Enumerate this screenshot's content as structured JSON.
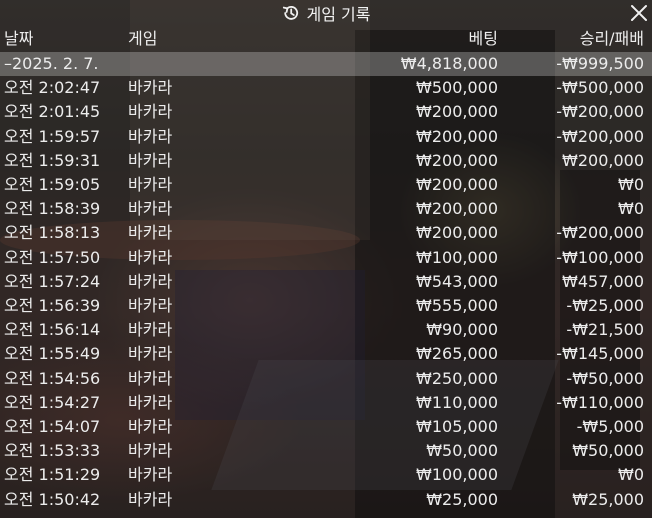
{
  "title": "게임 기록",
  "icons": {
    "title": "history-icon",
    "close": "close-icon"
  },
  "columns": {
    "date": "날짜",
    "game": "게임",
    "bet": "베팅",
    "result": "승리/패배"
  },
  "summary": {
    "date": "–2025. 2. 7.",
    "game": "",
    "bet": "₩4,818,000",
    "result": "-₩999,500"
  },
  "rows": [
    {
      "time": "오전 2:02:47",
      "game": "바카라",
      "bet": "₩500,000",
      "result": "-₩500,000"
    },
    {
      "time": "오전 2:01:45",
      "game": "바카라",
      "bet": "₩200,000",
      "result": "-₩200,000"
    },
    {
      "time": "오전 1:59:57",
      "game": "바카라",
      "bet": "₩200,000",
      "result": "-₩200,000"
    },
    {
      "time": "오전 1:59:31",
      "game": "바카라",
      "bet": "₩200,000",
      "result": "₩200,000"
    },
    {
      "time": "오전 1:59:05",
      "game": "바카라",
      "bet": "₩200,000",
      "result": "₩0"
    },
    {
      "time": "오전 1:58:39",
      "game": "바카라",
      "bet": "₩200,000",
      "result": "₩0"
    },
    {
      "time": "오전 1:58:13",
      "game": "바카라",
      "bet": "₩200,000",
      "result": "-₩200,000"
    },
    {
      "time": "오전 1:57:50",
      "game": "바카라",
      "bet": "₩100,000",
      "result": "-₩100,000"
    },
    {
      "time": "오전 1:57:24",
      "game": "바카라",
      "bet": "₩543,000",
      "result": "₩457,000"
    },
    {
      "time": "오전 1:56:39",
      "game": "바카라",
      "bet": "₩555,000",
      "result": "-₩25,000"
    },
    {
      "time": "오전 1:56:14",
      "game": "바카라",
      "bet": "₩90,000",
      "result": "-₩21,500"
    },
    {
      "time": "오전 1:55:49",
      "game": "바카라",
      "bet": "₩265,000",
      "result": "-₩145,000"
    },
    {
      "time": "오전 1:54:56",
      "game": "바카라",
      "bet": "₩250,000",
      "result": "-₩50,000"
    },
    {
      "time": "오전 1:54:27",
      "game": "바카라",
      "bet": "₩110,000",
      "result": "-₩110,000"
    },
    {
      "time": "오전 1:54:07",
      "game": "바카라",
      "bet": "₩105,000",
      "result": "-₩5,000"
    },
    {
      "time": "오전 1:53:33",
      "game": "바카라",
      "bet": "₩50,000",
      "result": "₩50,000"
    },
    {
      "time": "오전 1:51:29",
      "game": "바카라",
      "bet": "₩100,000",
      "result": "₩0"
    },
    {
      "time": "오전 1:50:42",
      "game": "바카라",
      "bet": "₩25,000",
      "result": "₩25,000"
    }
  ]
}
